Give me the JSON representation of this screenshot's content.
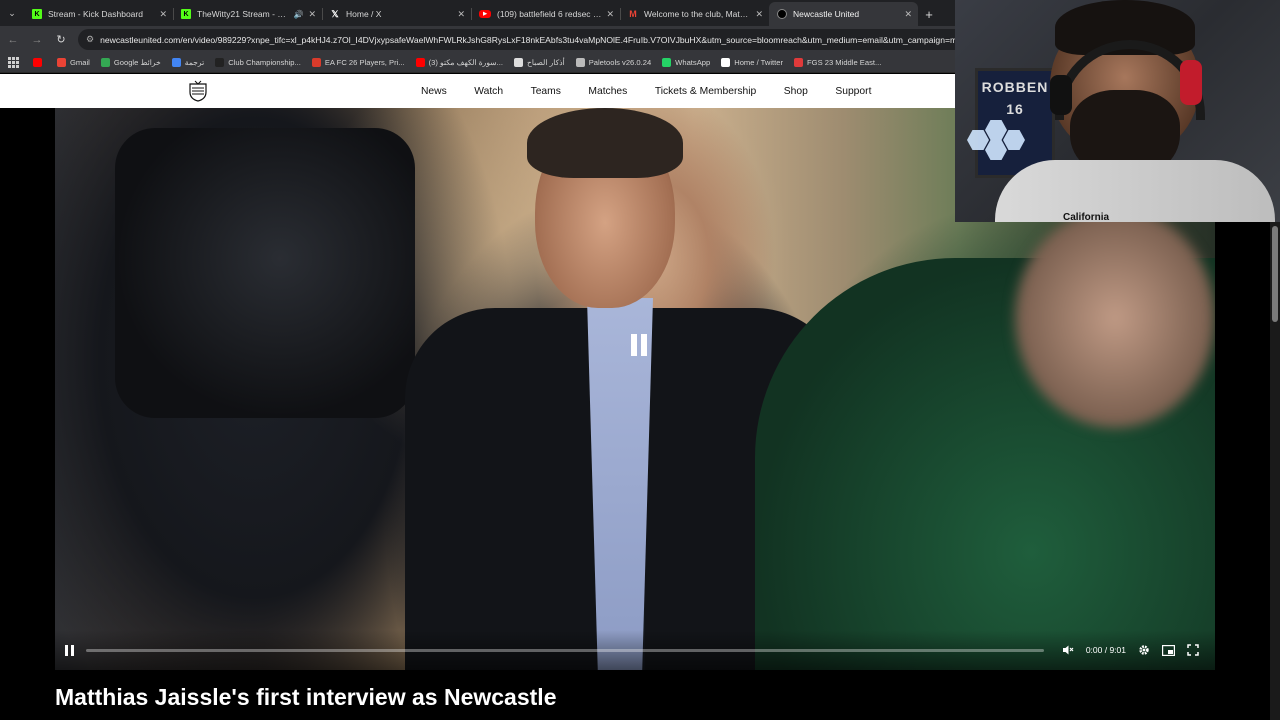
{
  "browser": {
    "tabs": [
      {
        "title": "Stream - Kick Dashboard",
        "favicon": "kick-icon",
        "active": false
      },
      {
        "title": "TheWitty21 Stream - Watch",
        "favicon": "kick-icon",
        "active": false,
        "audio": true
      },
      {
        "title": "Home / X",
        "favicon": "x-icon",
        "active": false
      },
      {
        "title": "(109) battlefield 6 redsec how t",
        "favicon": "youtube-icon",
        "active": false
      },
      {
        "title": "Welcome to the club, Matthias",
        "favicon": "gmail-icon",
        "active": false
      },
      {
        "title": "Newcastle United",
        "favicon": "nufc-icon",
        "active": true
      }
    ],
    "new_tab": "+",
    "url": "newcastleunited.com/en/video/989229?xnpe_tifc=xl_p4kHJ4.z7Ol_I4DVjxypsafeWaelWhFWLRkJshG8RysLxF18nkEAbfs3tu4vaMpNOlE.4FruIb.V7OIVJbuHX&utm_source=bloomreach&utm_medium=email&utm_campaign=m",
    "bookmarks": [
      {
        "label": "",
        "icon": "youtube-icon",
        "color": "#ff0000"
      },
      {
        "label": "Gmail",
        "icon": "gmail-icon",
        "color": "#ea4335"
      },
      {
        "label": "Google خرائط",
        "icon": "maps-icon",
        "color": "#34a853"
      },
      {
        "label": "ترجمة",
        "icon": "translate-icon",
        "color": "#4285f4"
      },
      {
        "label": "Club Championship...",
        "icon": "ea-icon",
        "color": "#222222"
      },
      {
        "label": "EA FC 26 Players, Pri...",
        "icon": "futbin-icon",
        "color": "#d93b2b"
      },
      {
        "label": "(3) سورة الكهف مكتو...",
        "icon": "youtube-icon",
        "color": "#ff0000"
      },
      {
        "label": "أذكار الصباح",
        "icon": "bookmark-icon",
        "color": "#dddddd"
      },
      {
        "label": "Paletools v26.0.24",
        "icon": "paletools-icon",
        "color": "#bbbbbb"
      },
      {
        "label": "WhatsApp",
        "icon": "whatsapp-icon",
        "color": "#25d366"
      },
      {
        "label": "Home / Twitter",
        "icon": "x-icon",
        "color": "#ffffff"
      },
      {
        "label": "FGS 23 Middle East...",
        "icon": "fgs-icon",
        "color": "#e03a3a"
      }
    ]
  },
  "site": {
    "nav": [
      "News",
      "Watch",
      "Teams",
      "Matches",
      "Tickets & Membership",
      "Shop",
      "Support"
    ]
  },
  "video": {
    "time": "0:00 / 9:01",
    "progress": 0,
    "title": "Matthias Jaissle's first interview as Newcastle"
  },
  "webcam": {
    "frame_text": "ROBBEN\n16",
    "shirt_text": "California"
  }
}
